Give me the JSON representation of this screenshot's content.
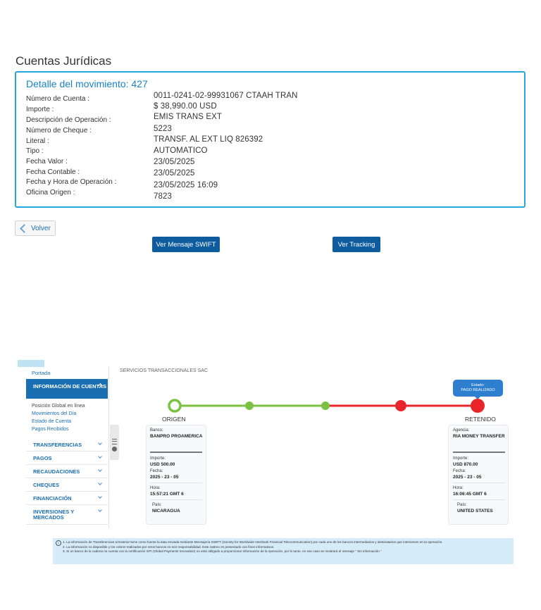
{
  "page_title": "Cuentas Jurídicas",
  "detail": {
    "title": "Detalle del movimiento: 427",
    "fields": [
      {
        "label": "Número de Cuenta :",
        "value": "0011-0241-02-99931067 CTAAH TRAN"
      },
      {
        "label": "Importe :",
        "value": "$ 38,990.00 USD"
      },
      {
        "label": "Descripción de Operación :",
        "value": "EMIS TRANS EXT"
      },
      {
        "label": "Número de Cheque :",
        "value": "5223"
      },
      {
        "label": "Literal :",
        "value": "TRANSF. AL EXT LIQ 826392"
      },
      {
        "label": "Tipo :",
        "value": "AUTOMATICO"
      },
      {
        "label": "Fecha Valor :",
        "value": "23/05/2025"
      },
      {
        "label": "Fecha Contable :",
        "value": "23/05/2025"
      },
      {
        "label": "Fecha y Hora de Operación :",
        "value": "23/05/2025 16:09"
      },
      {
        "label": "Oficina Origen :",
        "value": "7823"
      }
    ]
  },
  "buttons": {
    "back": "Volver",
    "swift": "Ver Mensaje SWIFT",
    "tracking": "Ver Tracking"
  },
  "sidebar": {
    "portada": "Portada",
    "active_section": "INFORMACIÓN DE CUENTAS",
    "sub_items": [
      {
        "label": "Posición Global en línea",
        "color": "#444444"
      },
      {
        "label": "Movimientos del Día",
        "color": "#1a6fb3"
      },
      {
        "label": "Estado de Cuenta",
        "color": "#1a6fb3"
      },
      {
        "label": "Pagos Recibidos",
        "color": "#1a6fb3"
      }
    ],
    "menu": [
      "TRANSFERENCIAS",
      "PAGOS",
      "RECAUDACIONES",
      "CHEQUES",
      "FINANCIACIÓN",
      "INVERSIONES Y MERCADOS"
    ]
  },
  "tracking": {
    "header": "SERVICIOS TRANSACCIONALES SAC",
    "status": {
      "label": "Estado:",
      "value": "PAGO REALIZADO"
    },
    "origin_label": "ORIGEN",
    "dest_label": "RETENIDO",
    "colors": {
      "green": "#7cc242",
      "red": "#e8262a"
    },
    "origin_card": {
      "bank_key": "Banco:",
      "bank": "BANPRO PROAMERICA",
      "amount_key": "Importe:",
      "amount": "USD 500.00",
      "date_key": "Fecha:",
      "date": "2025 - 23 - 05",
      "time_key": "Hora:",
      "time": "15:57:21 GMT 6",
      "country_key": "País:",
      "country": "NICARAGUA"
    },
    "dest_card": {
      "bank_key": "Agencia:",
      "bank": "RIA MONEY TRANSFER",
      "amount_key": "Importe:",
      "amount": "USD 870.00",
      "date_key": "Fecha:",
      "date": "2025 - 23 - 05",
      "time_key": "Hora:",
      "time": "16:06:45 GMT 6",
      "country_key": "País:",
      "country": "UNITED STATES"
    }
  },
  "notes": [
    "1. La información de Transferencias al Exterior tiene como fuente la data enviada mediante Mensajería SWIFT (Society for Worldwide Interbank Financial Telecommunication) por cada uno de los bancos intermediarios y destinatarios que intervienen en la operación.",
    "2. La información no disponible y los cobros realizados por otros bancos no son responsabilidad. Este rastreo es presentado con fines informativos.",
    "3. Si un banco de la cadena no cuenta con la certificación GPI (Global Payments Innovation) no está obligado a proporcionar información de la operación, por lo tanto, en ese caso se mostrará el mensaje \" Sin información \""
  ]
}
